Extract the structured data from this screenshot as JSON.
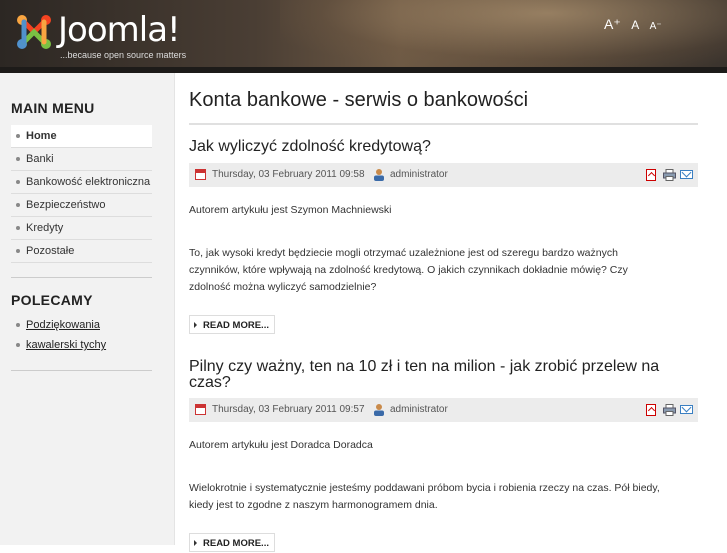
{
  "header": {
    "logo_text": "Joomla!",
    "logo_tagline": "...because open source matters",
    "font_size": {
      "larger": "A⁺",
      "default": "A",
      "smaller": "A⁻"
    }
  },
  "sidebar": {
    "main_menu": {
      "title": "MAIN MENU",
      "items": [
        {
          "label": "Home",
          "active": true
        },
        {
          "label": "Banki"
        },
        {
          "label": "Bankowość elektroniczna"
        },
        {
          "label": "Bezpieczeństwo"
        },
        {
          "label": "Kredyty"
        },
        {
          "label": "Pozostałe"
        }
      ]
    },
    "polecamy": {
      "title": "POLECAMY",
      "links": [
        {
          "label": "Podziękowania"
        },
        {
          "label": "kawalerski tychy"
        }
      ]
    }
  },
  "main": {
    "page_title": "Konta bankowe - serwis o bankowości",
    "articles": [
      {
        "title": "Jak wyliczyć zdolność kredytową?",
        "date": "Thursday, 03 February 2011 09:58",
        "author": "administrator",
        "paragraphs": [
          "Autorem artykułu jest Szymon Machniewski",
          "To, jak wysoki kredyt będziecie mogli otrzymać uzależnione jest od szeregu bardzo ważnych czynników, które wpływają na zdolność kredytową. O jakich czynnikach dokładnie mówię? Czy zdolność można wyliczyć samodzielnie?"
        ],
        "read_more": "READ MORE..."
      },
      {
        "title": "Pilny czy ważny, ten na 10 zł i ten na milion - jak zrobić przelew na czas?",
        "date": "Thursday, 03 February 2011 09:57",
        "author": "administrator",
        "paragraphs": [
          "Autorem artykułu jest Doradca Doradca",
          "Wielokrotnie i systematycznie jesteśmy poddawani próbom bycia i robienia rzeczy na czas. Pół biedy, kiedy jest to zgodne z naszym harmonogramem dnia."
        ],
        "read_more": "READ MORE..."
      }
    ]
  },
  "colors": {
    "header_dark": "#2c2723",
    "sidebar_bg": "#f2f2f2",
    "meta_bg": "#ececec",
    "pdf_red": "#cc0000",
    "mail_blue": "#3a7fc2"
  },
  "icons": [
    "joomla-logo-icon",
    "calendar-icon",
    "user-icon",
    "pdf-icon",
    "print-icon",
    "email-icon",
    "bullet-icon",
    "arrow-right-icon"
  ]
}
